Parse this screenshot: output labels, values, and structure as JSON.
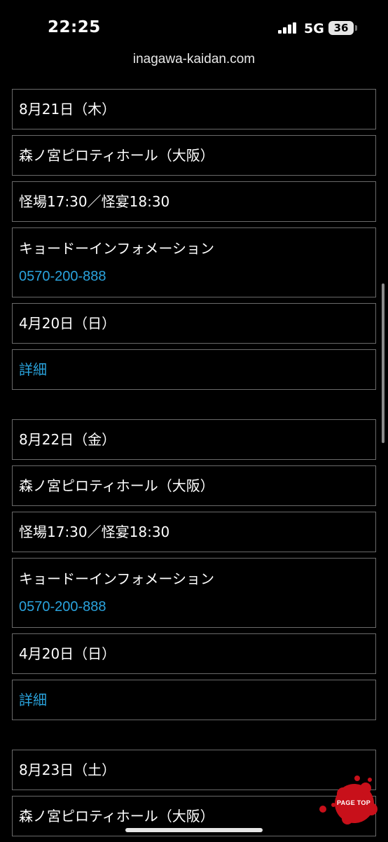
{
  "status_bar": {
    "time": "22:25",
    "network": "5G",
    "battery": "36"
  },
  "url": "inagawa-kaidan.com",
  "events": [
    {
      "date": "8月21日（木）",
      "venue": "森ノ宮ピロティホール（大阪）",
      "times": "怪場17:30／怪宴18:30",
      "contact_name": "キョードーインフォメーション",
      "contact_phone": "0570-200-888",
      "sale_date": "4月20日（日）",
      "detail_label": "詳細"
    },
    {
      "date": "8月22日（金）",
      "venue": "森ノ宮ピロティホール（大阪）",
      "times": "怪場17:30／怪宴18:30",
      "contact_name": "キョードーインフォメーション",
      "contact_phone": "0570-200-888",
      "sale_date": "4月20日（日）",
      "detail_label": "詳細"
    },
    {
      "date": "8月23日（土）",
      "venue": "森ノ宮ピロティホール（大阪）"
    }
  ],
  "page_top": {
    "label": "PAGE TOP",
    "accent_color": "#c8101a"
  },
  "colors": {
    "link": "#2aa3dd",
    "border": "#6a6a6a",
    "background": "#000000"
  }
}
